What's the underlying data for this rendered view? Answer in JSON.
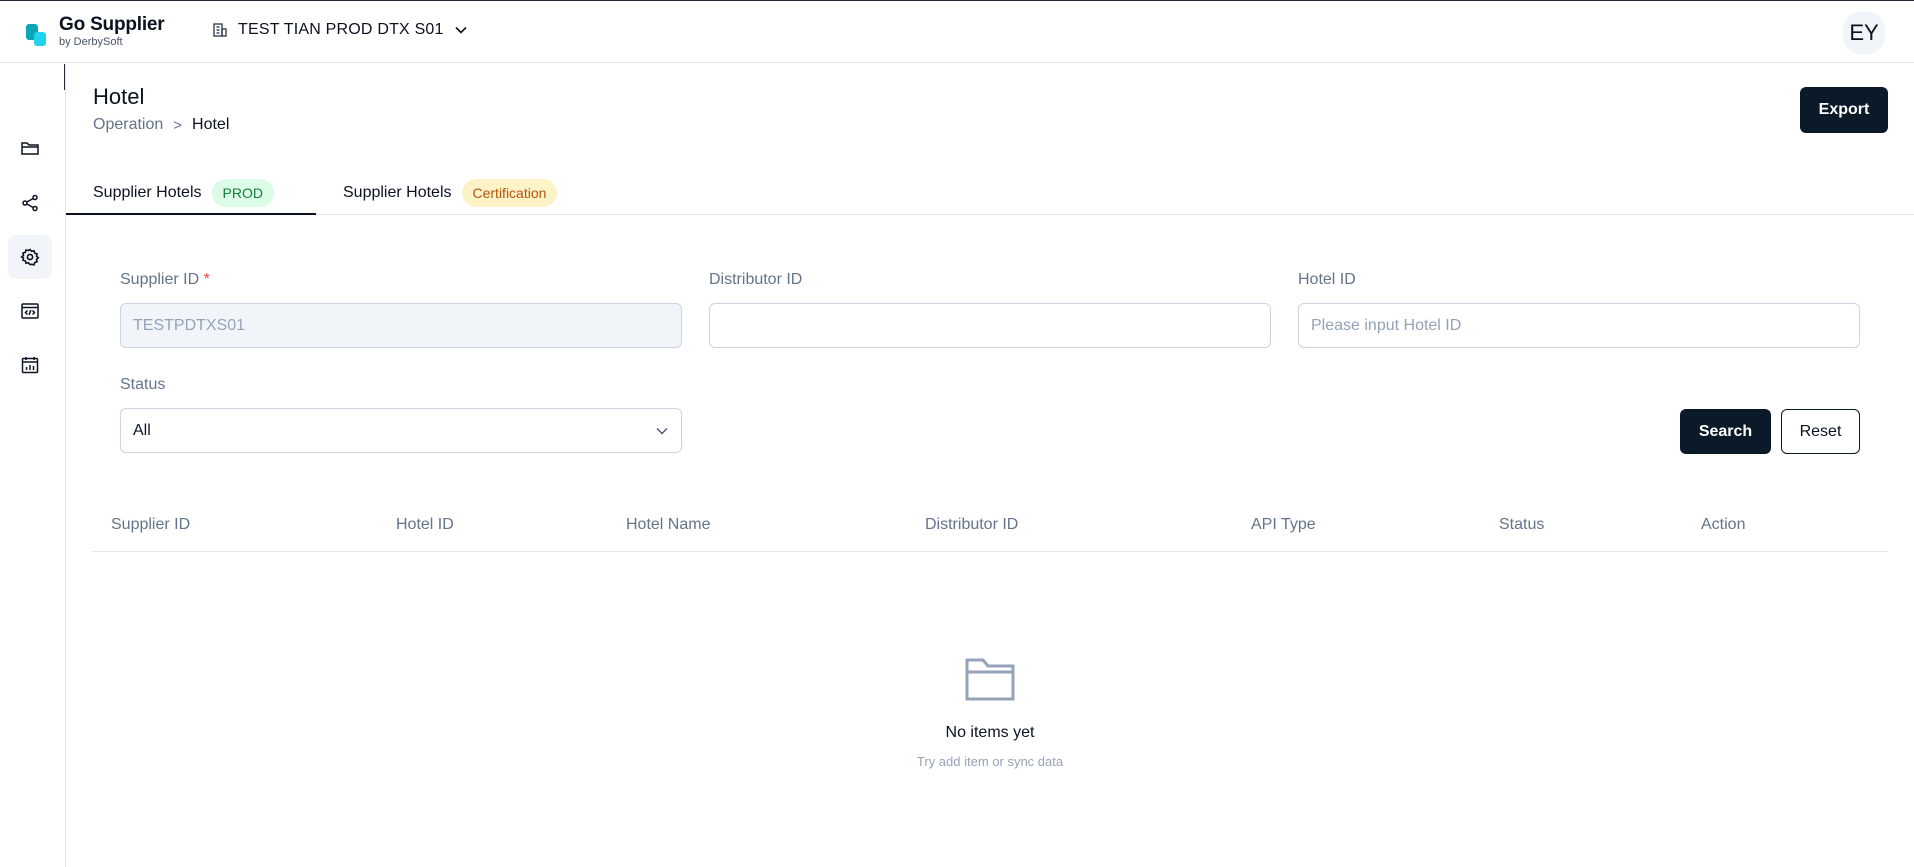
{
  "app": {
    "name": "Go Supplier",
    "byline": "by DerbySoft",
    "org_selector": "TEST TIAN PROD DTX S01",
    "avatar_initials": "EY"
  },
  "sidebar": {
    "items": [
      {
        "icon": "folder-icon",
        "active": false
      },
      {
        "icon": "share-icon",
        "active": false
      },
      {
        "icon": "gear-icon",
        "active": true
      },
      {
        "icon": "code-window-icon",
        "active": false
      },
      {
        "icon": "calendar-chart-icon",
        "active": false
      }
    ]
  },
  "page": {
    "title": "Hotel",
    "breadcrumb": [
      "Operation",
      "Hotel"
    ],
    "breadcrumb_separator": ">",
    "export_label": "Export"
  },
  "tabs": [
    {
      "label": "Supplier Hotels",
      "badge": "PROD",
      "active": true
    },
    {
      "label": "Supplier Hotels",
      "badge": "Certification",
      "active": false
    }
  ],
  "filters": {
    "supplier_id": {
      "label": "Supplier ID",
      "required_mark": "*",
      "value": "TESTPDTXS01"
    },
    "distributor_id": {
      "label": "Distributor ID",
      "value": ""
    },
    "hotel_id": {
      "label": "Hotel ID",
      "placeholder": "Please input Hotel ID"
    },
    "status": {
      "label": "Status",
      "value": "All"
    },
    "search_label": "Search",
    "reset_label": "Reset"
  },
  "table": {
    "columns": [
      "Supplier ID",
      "Hotel ID",
      "Hotel Name",
      "Distributor ID",
      "API Type",
      "Status",
      "Action"
    ],
    "rows": []
  },
  "empty_state": {
    "title": "No items yet",
    "subtitle": "Try add item or sync data"
  },
  "colors": {
    "primary_dark": "#0b1a28",
    "prod_badge_bg": "#dcfce7",
    "prod_badge_text": "#15803d",
    "cert_badge_bg": "#fef3c7",
    "cert_badge_text": "#b45309",
    "brand_accent": "#22d3ee"
  }
}
